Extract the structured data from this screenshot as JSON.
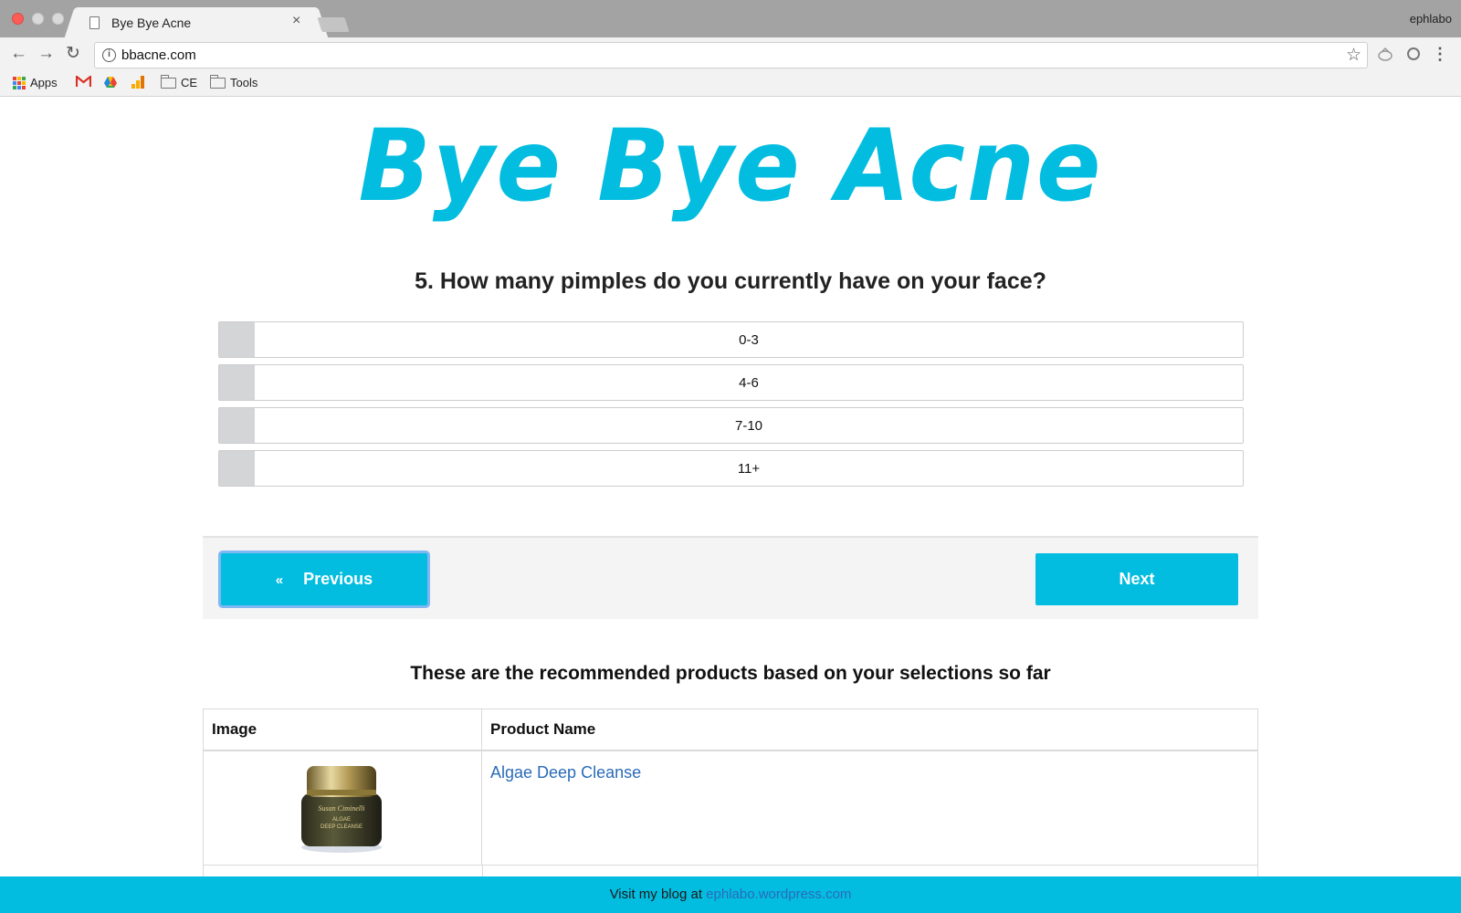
{
  "browser": {
    "tab_title": "Bye Bye Acne",
    "profile_name": "ephlabo",
    "url": "bbacne.com",
    "bookmarks": [
      {
        "label": "Apps",
        "icon": "apps-grid-icon"
      },
      {
        "label": "",
        "icon": "gmail-icon"
      },
      {
        "label": "",
        "icon": "drive-icon"
      },
      {
        "label": "",
        "icon": "analytics-icon"
      },
      {
        "label": "CE",
        "icon": "folder-icon"
      },
      {
        "label": "Tools",
        "icon": "folder-icon"
      }
    ]
  },
  "page": {
    "logo": "Bye Bye Acne",
    "question": "5. How many pimples do you currently have on your face?",
    "options": [
      {
        "label": "0-3"
      },
      {
        "label": "4-6"
      },
      {
        "label": "7-10"
      },
      {
        "label": "11+"
      }
    ],
    "previous_label": "Previous",
    "previous_glyph": "«",
    "next_label": "Next",
    "recommendations_title": "These are the recommended products based on your selections so far",
    "table": {
      "headers": [
        "Image",
        "Product Name"
      ],
      "rows": [
        {
          "image_alt": "product-jar",
          "name": "Algae Deep Cleanse"
        }
      ]
    },
    "jar_label": {
      "brand": "Susan Ciminelli",
      "line1": "ALGAE",
      "line2": "DEEP CLEANSE"
    }
  },
  "footer": {
    "text": "Visit my blog at ",
    "link": "ephlabo.wordpress.com"
  },
  "colors": {
    "accent": "#02bde0",
    "link": "#2a6bb8",
    "option_box": "#d4d5d7",
    "focus_ring": "#7fb7f2"
  }
}
